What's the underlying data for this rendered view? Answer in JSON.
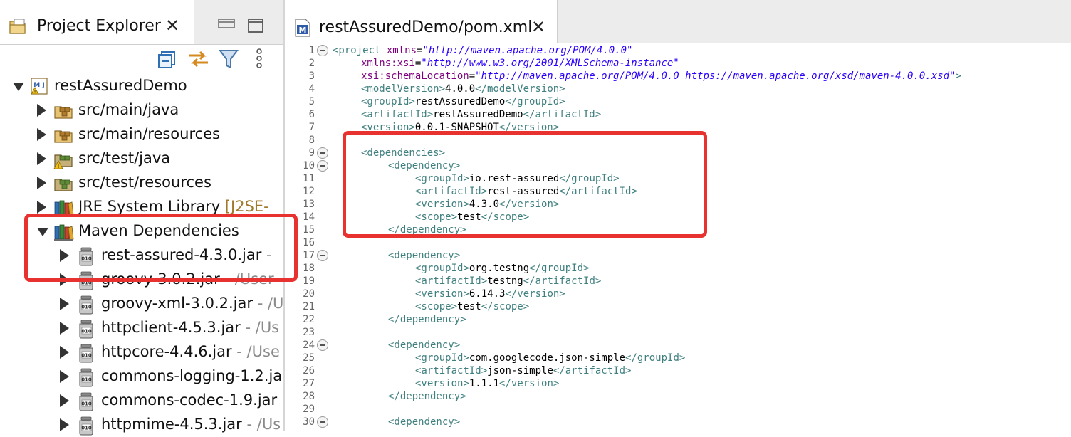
{
  "project_explorer": {
    "title": "Project Explorer",
    "close_glyph": "✕",
    "tree": [
      {
        "label": "restAssuredDemo",
        "deco": "",
        "expanded": true,
        "indent": 0,
        "icon": "maven-project-icon"
      },
      {
        "label": "src/main/java",
        "deco": "",
        "expanded": false,
        "indent": 1,
        "icon": "package-folder-icon"
      },
      {
        "label": "src/main/resources",
        "deco": "",
        "expanded": false,
        "indent": 1,
        "icon": "package-folder-icon"
      },
      {
        "label": "src/test/java",
        "deco": "",
        "expanded": false,
        "indent": 1,
        "icon": "test-folder-warning-icon"
      },
      {
        "label": "src/test/resources",
        "deco": "",
        "expanded": false,
        "indent": 1,
        "icon": "test-folder-icon"
      },
      {
        "label": "JRE System Library",
        "deco": "[J2SE-",
        "expanded": false,
        "indent": 1,
        "icon": "library-icon"
      },
      {
        "label": "Maven Dependencies",
        "deco": "",
        "expanded": true,
        "indent": 1,
        "icon": "library-icon"
      },
      {
        "label": "rest-assured-4.3.0.jar",
        "deco": "- ",
        "expanded": false,
        "indent": 2,
        "icon": "jar-icon"
      },
      {
        "label": "groovy-3.0.2.jar",
        "deco": "- /User",
        "expanded": false,
        "indent": 2,
        "icon": "jar-icon"
      },
      {
        "label": "groovy-xml-3.0.2.jar",
        "deco": "- /U",
        "expanded": false,
        "indent": 2,
        "icon": "jar-icon"
      },
      {
        "label": "httpclient-4.5.3.jar",
        "deco": "- /Us",
        "expanded": false,
        "indent": 2,
        "icon": "jar-icon"
      },
      {
        "label": "httpcore-4.4.6.jar",
        "deco": "- /Use",
        "expanded": false,
        "indent": 2,
        "icon": "jar-icon"
      },
      {
        "label": "commons-logging-1.2.ja",
        "deco": "",
        "expanded": false,
        "indent": 2,
        "icon": "jar-icon"
      },
      {
        "label": "commons-codec-1.9.jar",
        "deco": "",
        "expanded": false,
        "indent": 2,
        "icon": "jar-icon"
      },
      {
        "label": "httpmime-4.5.3.jar",
        "deco": "- /Us",
        "expanded": false,
        "indent": 2,
        "icon": "jar-icon"
      }
    ]
  },
  "editor": {
    "tab_title": "restAssuredDemo/pom.xml",
    "close_glyph": "✕",
    "lines": [
      {
        "n": "1",
        "fold": true,
        "indent": 0,
        "segs": [
          [
            "t",
            "<project "
          ],
          [
            "a",
            "xmlns"
          ],
          [
            "p",
            "="
          ],
          [
            "v",
            "\"http://maven.apache.org/POM/4.0.0\""
          ]
        ]
      },
      {
        "n": "2",
        "fold": false,
        "indent": 1,
        "segs": [
          [
            "a",
            "xmlns:xsi"
          ],
          [
            "p",
            "="
          ],
          [
            "v",
            "\"http://www.w3.org/2001/XMLSchema-instance\""
          ]
        ]
      },
      {
        "n": "3",
        "fold": false,
        "indent": 1,
        "segs": [
          [
            "a",
            "xsi:schemaLocation"
          ],
          [
            "p",
            "="
          ],
          [
            "v",
            "\"http://maven.apache.org/POM/4.0.0 https://maven.apache.org/xsd/maven-4.0.0.xsd\""
          ],
          [
            "t",
            ">"
          ]
        ]
      },
      {
        "n": "4",
        "fold": false,
        "indent": 1,
        "segs": [
          [
            "t",
            "<modelVersion>"
          ],
          [
            "p",
            "4.0.0"
          ],
          [
            "t",
            "</modelVersion>"
          ]
        ]
      },
      {
        "n": "5",
        "fold": false,
        "indent": 1,
        "segs": [
          [
            "t",
            "<groupId>"
          ],
          [
            "p",
            "restAssuredDemo"
          ],
          [
            "t",
            "</groupId>"
          ]
        ]
      },
      {
        "n": "6",
        "fold": false,
        "indent": 1,
        "segs": [
          [
            "t",
            "<artifactId>"
          ],
          [
            "p",
            "restAssuredDemo"
          ],
          [
            "t",
            "</artifactId>"
          ]
        ]
      },
      {
        "n": "7",
        "fold": false,
        "indent": 1,
        "segs": [
          [
            "t",
            "<version>"
          ],
          [
            "p",
            "0.0.1-SNAPSHOT"
          ],
          [
            "t",
            "</version>"
          ]
        ]
      },
      {
        "n": "8",
        "fold": false,
        "indent": 0,
        "segs": []
      },
      {
        "n": "9",
        "fold": true,
        "indent": 1,
        "segs": [
          [
            "t",
            "<dependencies>"
          ]
        ]
      },
      {
        "n": "10",
        "fold": true,
        "indent": 2,
        "segs": [
          [
            "t",
            "<dependency>"
          ]
        ]
      },
      {
        "n": "11",
        "fold": false,
        "indent": 3,
        "segs": [
          [
            "t",
            "<groupId>"
          ],
          [
            "p",
            "io.rest-assured"
          ],
          [
            "t",
            "</groupId>"
          ]
        ]
      },
      {
        "n": "12",
        "fold": false,
        "indent": 3,
        "segs": [
          [
            "t",
            "<artifactId>"
          ],
          [
            "p",
            "rest-assured"
          ],
          [
            "t",
            "</artifactId>"
          ]
        ]
      },
      {
        "n": "13",
        "fold": false,
        "indent": 3,
        "segs": [
          [
            "t",
            "<version>"
          ],
          [
            "p",
            "4.3.0"
          ],
          [
            "t",
            "</version>"
          ]
        ]
      },
      {
        "n": "14",
        "fold": false,
        "indent": 3,
        "segs": [
          [
            "t",
            "<scope>"
          ],
          [
            "p",
            "test"
          ],
          [
            "t",
            "</scope>"
          ]
        ]
      },
      {
        "n": "15",
        "fold": false,
        "indent": 2,
        "segs": [
          [
            "t",
            "</dependency>"
          ]
        ]
      },
      {
        "n": "16",
        "fold": false,
        "indent": 0,
        "segs": []
      },
      {
        "n": "17",
        "fold": true,
        "indent": 2,
        "segs": [
          [
            "t",
            "<dependency>"
          ]
        ]
      },
      {
        "n": "18",
        "fold": false,
        "indent": 3,
        "segs": [
          [
            "t",
            "<groupId>"
          ],
          [
            "p",
            "org.testng"
          ],
          [
            "t",
            "</groupId>"
          ]
        ]
      },
      {
        "n": "19",
        "fold": false,
        "indent": 3,
        "segs": [
          [
            "t",
            "<artifactId>"
          ],
          [
            "p",
            "testng"
          ],
          [
            "t",
            "</artifactId>"
          ]
        ]
      },
      {
        "n": "20",
        "fold": false,
        "indent": 3,
        "segs": [
          [
            "t",
            "<version>"
          ],
          [
            "p",
            "6.14.3"
          ],
          [
            "t",
            "</version>"
          ]
        ]
      },
      {
        "n": "21",
        "fold": false,
        "indent": 3,
        "segs": [
          [
            "t",
            "<scope>"
          ],
          [
            "p",
            "test"
          ],
          [
            "t",
            "</scope>"
          ]
        ]
      },
      {
        "n": "22",
        "fold": false,
        "indent": 2,
        "segs": [
          [
            "t",
            "</dependency>"
          ]
        ]
      },
      {
        "n": "23",
        "fold": false,
        "indent": 0,
        "segs": []
      },
      {
        "n": "24",
        "fold": true,
        "indent": 2,
        "segs": [
          [
            "t",
            "<dependency>"
          ]
        ]
      },
      {
        "n": "25",
        "fold": false,
        "indent": 3,
        "segs": [
          [
            "t",
            "<groupId>"
          ],
          [
            "p",
            "com.googlecode.json-simple"
          ],
          [
            "t",
            "</groupId>"
          ]
        ]
      },
      {
        "n": "26",
        "fold": false,
        "indent": 3,
        "segs": [
          [
            "t",
            "<artifactId>"
          ],
          [
            "p",
            "json-simple"
          ],
          [
            "t",
            "</artifactId>"
          ]
        ]
      },
      {
        "n": "27",
        "fold": false,
        "indent": 3,
        "segs": [
          [
            "t",
            "<version>"
          ],
          [
            "p",
            "1.1.1"
          ],
          [
            "t",
            "</version>"
          ]
        ]
      },
      {
        "n": "28",
        "fold": false,
        "indent": 2,
        "segs": [
          [
            "t",
            "</dependency>"
          ]
        ]
      },
      {
        "n": "29",
        "fold": false,
        "indent": 0,
        "segs": []
      },
      {
        "n": "30",
        "fold": true,
        "indent": 2,
        "segs": [
          [
            "t",
            "<dependency>"
          ]
        ]
      }
    ]
  },
  "colors": {
    "highlight": "#e8322f",
    "xml_tag": "#3f7f7f",
    "xml_attr": "#7f007f",
    "xml_value": "#2a00ff"
  }
}
